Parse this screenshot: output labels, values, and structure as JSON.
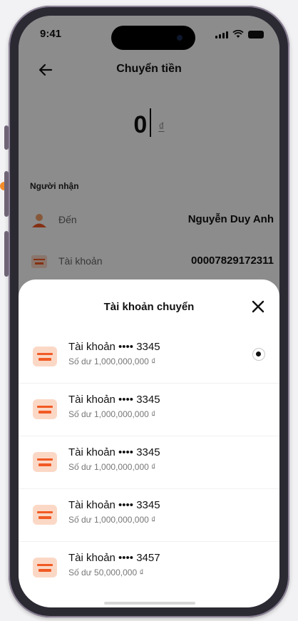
{
  "status_bar": {
    "time": "9:41"
  },
  "header": {
    "title": "Chuyển tiền"
  },
  "amount": {
    "value": "0",
    "currency": "₫"
  },
  "recipient": {
    "section_label": "Người nhận",
    "to_label": "Đến",
    "to_value": "Nguyễn Duy Anh",
    "account_label": "Tài khoản",
    "account_value": "00007829172311"
  },
  "sheet": {
    "title": "Tài khoản chuyển",
    "accounts": [
      {
        "name": "Tài khoản •••• 3345",
        "balance": "Số dư 1,000,000,000 ₫",
        "selected": true
      },
      {
        "name": "Tài khoản •••• 3345",
        "balance": "Số dư 1,000,000,000 ₫",
        "selected": false
      },
      {
        "name": "Tài khoản •••• 3345",
        "balance": "Số dư 1,000,000,000 ₫",
        "selected": false
      },
      {
        "name": "Tài khoản •••• 3345",
        "balance": "Số dư 1,000,000,000 ₫",
        "selected": false
      },
      {
        "name": "Tài khoản •••• 3457",
        "balance": "Số dư 50,000,000 ₫",
        "selected": false
      }
    ]
  },
  "colors": {
    "accent": "#f15a24",
    "icon_bg": "#fbd8c6"
  }
}
